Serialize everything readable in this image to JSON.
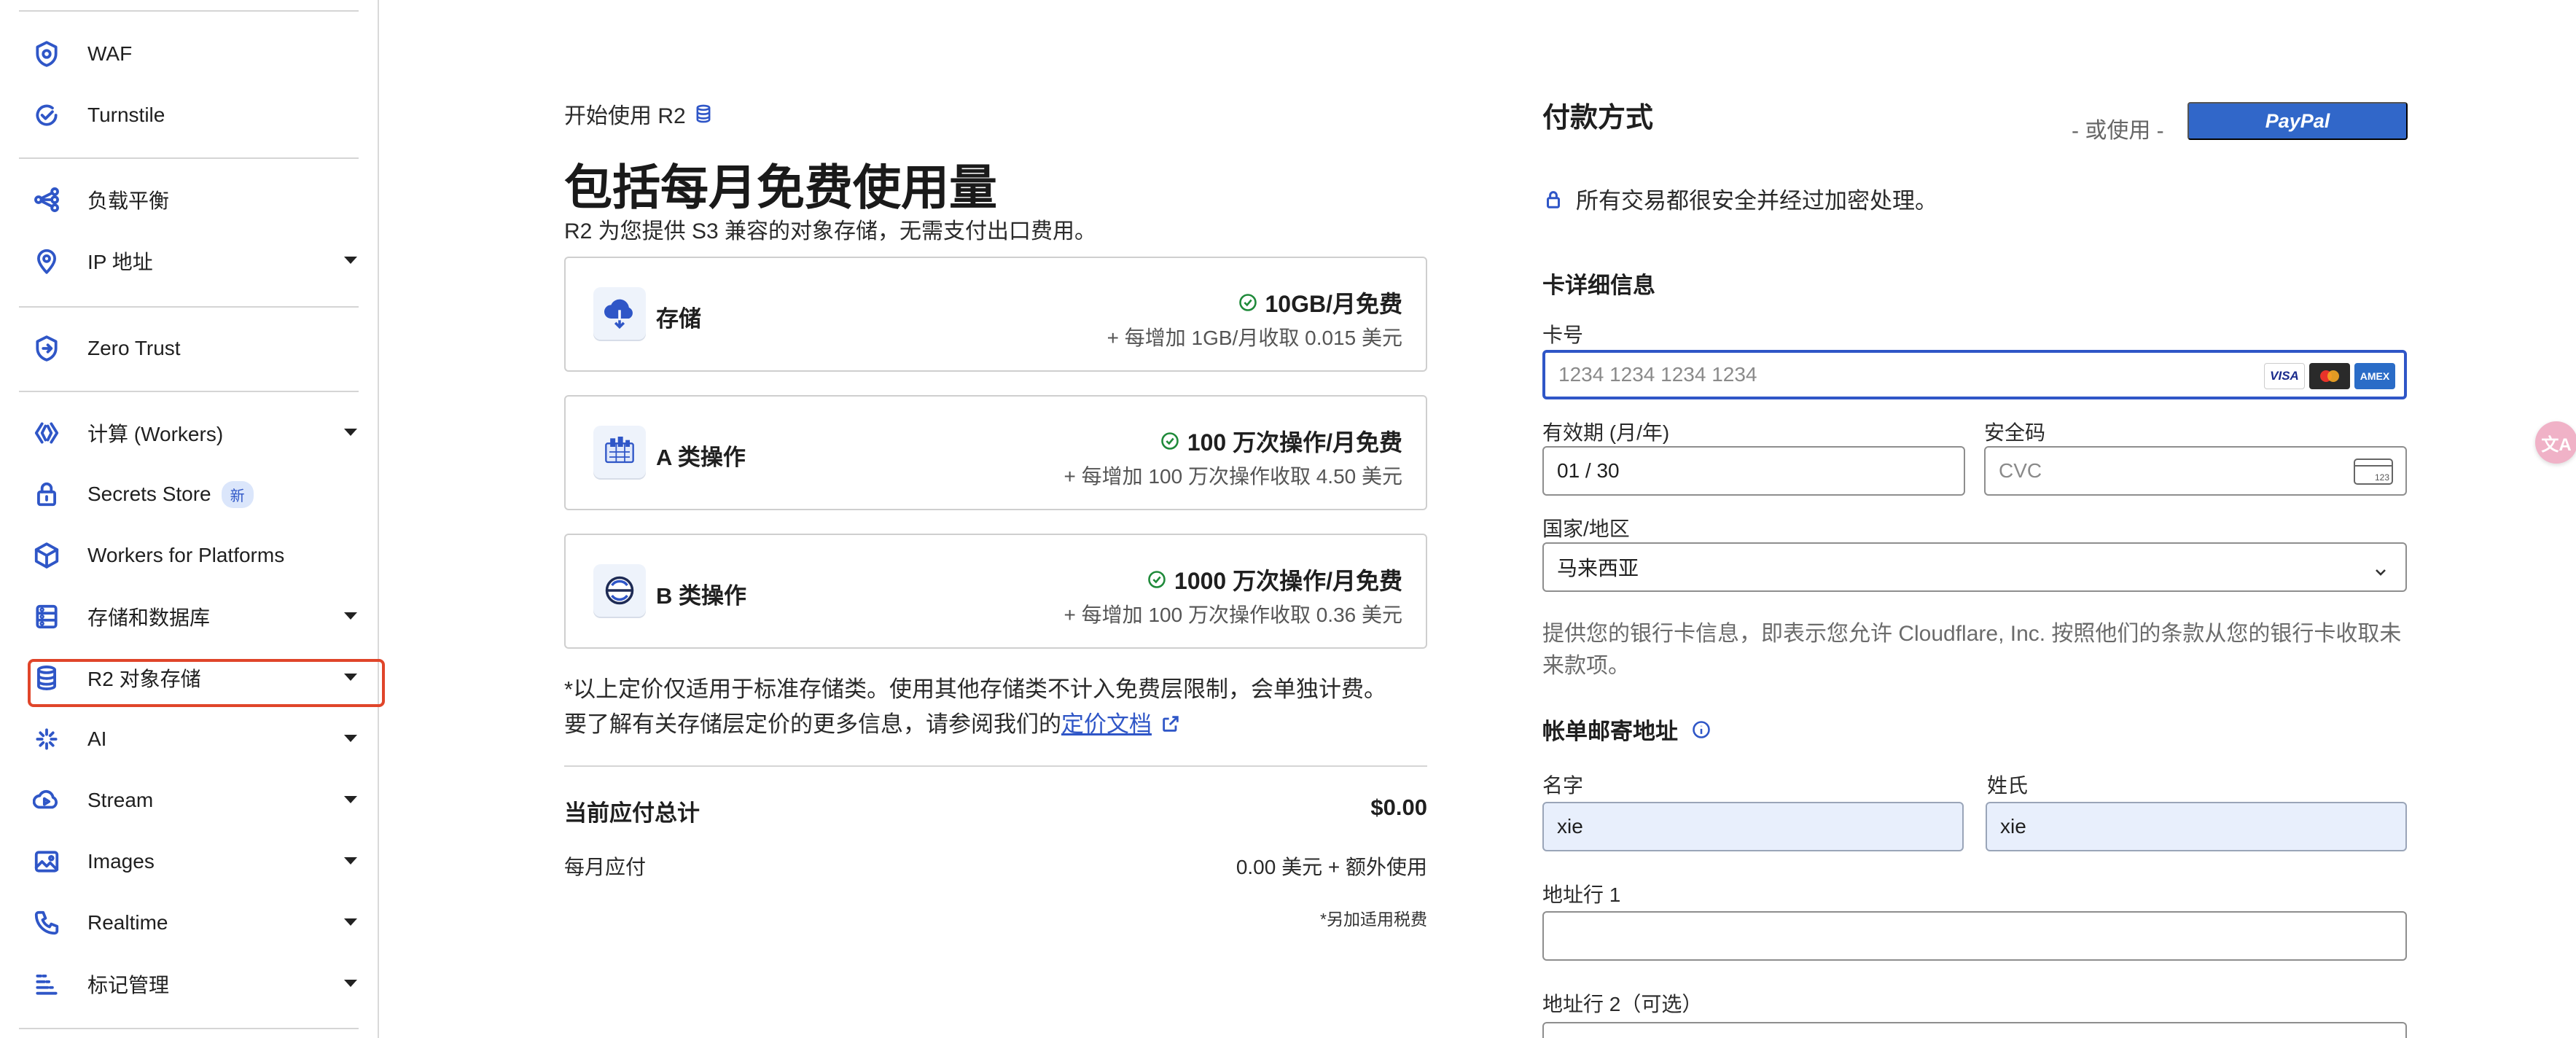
{
  "sidebar": {
    "items": [
      {
        "label": "WAF",
        "icon": "waf-icon"
      },
      {
        "label": "Turnstile",
        "icon": "turnstile-icon"
      },
      {
        "label": "负载平衡",
        "icon": "load-balancing-icon"
      },
      {
        "label": "IP 地址",
        "icon": "location-pin-icon"
      },
      {
        "label": "Zero Trust",
        "icon": "zero-trust-icon"
      },
      {
        "label": "计算 (Workers)",
        "icon": "workers-icon"
      },
      {
        "label": "Secrets Store",
        "icon": "lock-icon",
        "badge": "新"
      },
      {
        "label": "Workers for Platforms",
        "icon": "cube-icon"
      },
      {
        "label": "存储和数据库",
        "icon": "storage-icon"
      },
      {
        "label": "R2 对象存储",
        "icon": "database-icon"
      },
      {
        "label": "AI",
        "icon": "ai-sparkle-icon"
      },
      {
        "label": "Stream",
        "icon": "stream-icon"
      },
      {
        "label": "Images",
        "icon": "image-icon"
      },
      {
        "label": "Realtime",
        "icon": "phone-icon"
      },
      {
        "label": "标记管理",
        "icon": "tag-management-icon"
      }
    ],
    "highlight_color": "#e0452a"
  },
  "main": {
    "start_label": "开始使用 R2",
    "title": "包括每月免费使用量",
    "description": "R2 为您提供 S3 兼容的对象存储，无需支付出口费用。",
    "plans": [
      {
        "name": "存储",
        "free": "10GB/月免费",
        "extra": "+ 每增加 1GB/月收取 0.015 美元"
      },
      {
        "name": "A 类操作",
        "free": "100 万次操作/月免费",
        "extra": "+ 每增加 100 万次操作收取 4.50 美元"
      },
      {
        "name": "B 类操作",
        "free": "1000 万次操作/月免费",
        "extra": "+ 每增加 100 万次操作收取 0.36 美元"
      }
    ],
    "note_line1": "*以上定价仅适用于标准存储类。使用其他存储类不计入免费层限制，会单独计费。",
    "note_line2": "要了解有关存储层定价的更多信息，请参阅我们的",
    "note_link": "定价文档",
    "total_label": "当前应付总计",
    "total_value": "$0.00",
    "monthly_label": "每月应付",
    "monthly_value": "0.00 美元 + 额外使用",
    "tax_note": "*另加适用税费"
  },
  "payment": {
    "title": "付款方式",
    "or_use": "- 或使用 -",
    "paypal_label": "PayPal",
    "secure_text": "所有交易都很安全并经过加密处理。",
    "card_section_title": "卡详细信息",
    "card_number_label": "卡号",
    "card_number_placeholder": "1234 1234 1234 1234",
    "card_brands": [
      "VISA",
      "",
      "AMEX"
    ],
    "expiry_label": "有效期 (月/年)",
    "expiry_value": "01 / 30",
    "cvc_label": "安全码",
    "cvc_placeholder": "CVC",
    "cvc_icon_text": "123",
    "country_label": "国家/地区",
    "country_value": "马来西亚",
    "consent_text": "提供您的银行卡信息，即表示您允许 Cloudflare, Inc. 按照他们的条款从您的银行卡收取未来款项。",
    "billing_title": "帐单邮寄地址",
    "first_name_label": "名字",
    "first_name_value": "xie",
    "last_name_label": "姓氏",
    "last_name_value": "xie",
    "address1_label": "地址行 1",
    "address1_value": "",
    "address2_label": "地址行 2（可选）",
    "accent_color": "#2f56c7",
    "paypal_color": "#3167c9"
  },
  "floating": {
    "translate_label": "文A"
  }
}
